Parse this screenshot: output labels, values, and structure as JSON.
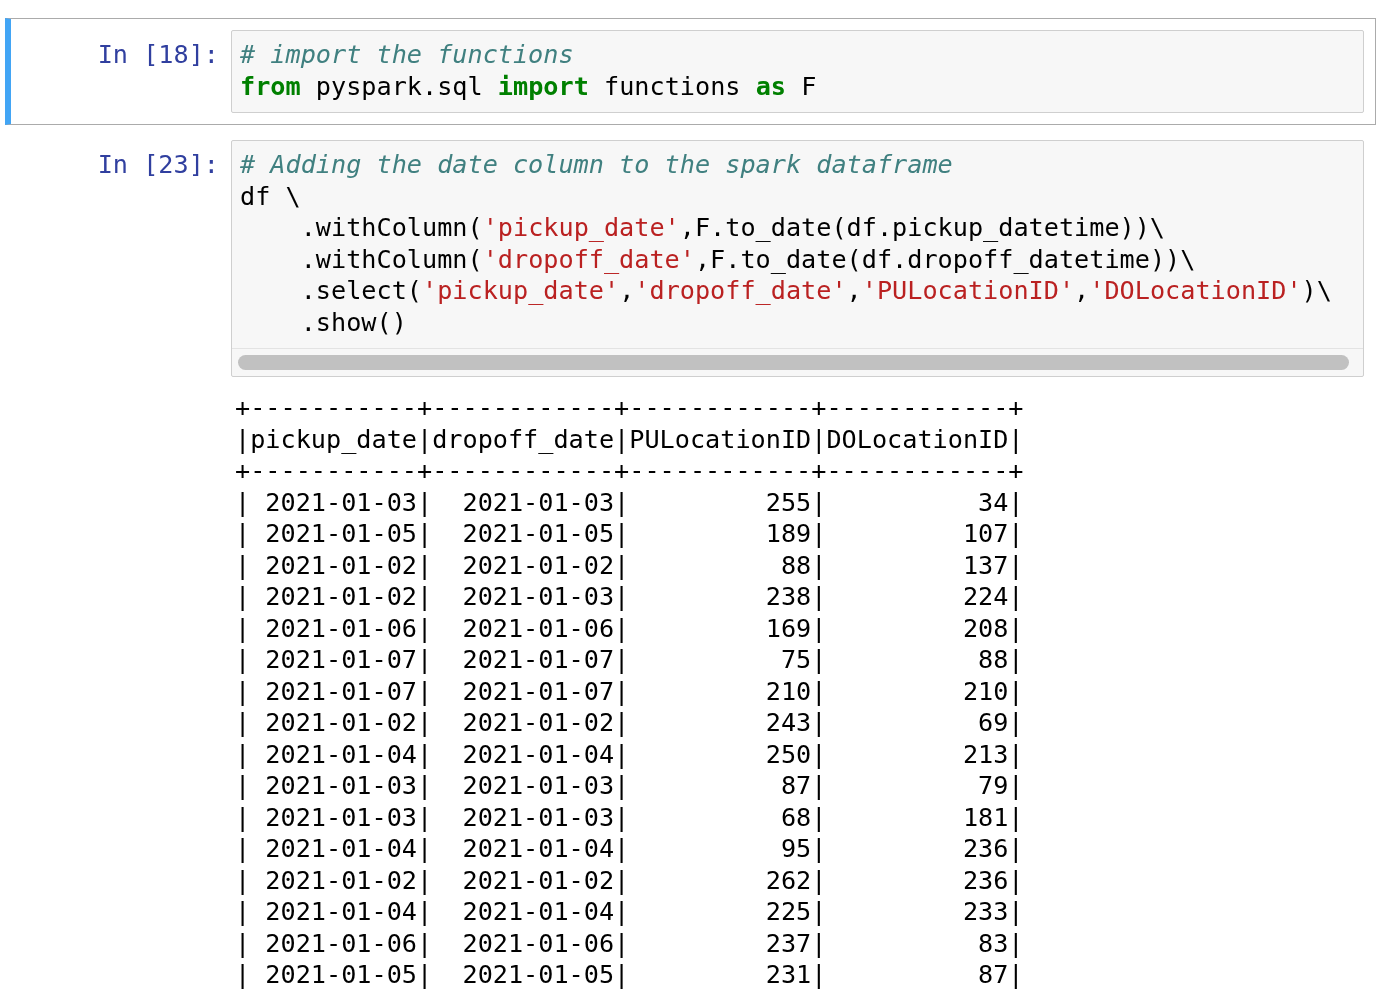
{
  "cells": [
    {
      "prompt": "In [18]:",
      "selected": true,
      "code_lines": [
        [
          {
            "kind": "comment",
            "text": "# import the functions"
          }
        ],
        [
          {
            "kind": "keyword",
            "text": "from"
          },
          {
            "kind": "plain",
            "text": " pyspark.sql "
          },
          {
            "kind": "keyword",
            "text": "import"
          },
          {
            "kind": "plain",
            "text": " functions "
          },
          {
            "kind": "keyword",
            "text": "as"
          },
          {
            "kind": "plain",
            "text": " F"
          }
        ]
      ],
      "scrollbar": false
    },
    {
      "prompt": "In [23]:",
      "selected": false,
      "code_lines": [
        [
          {
            "kind": "comment",
            "text": "# Adding the date column to the spark dataframe"
          }
        ],
        [
          {
            "kind": "plain",
            "text": "df \\"
          }
        ],
        [
          {
            "kind": "plain",
            "text": "    .withColumn("
          },
          {
            "kind": "string",
            "text": "'pickup_date'"
          },
          {
            "kind": "plain",
            "text": ",F.to_date(df.pickup_datetime))\\"
          }
        ],
        [
          {
            "kind": "plain",
            "text": "    .withColumn("
          },
          {
            "kind": "string",
            "text": "'dropoff_date'"
          },
          {
            "kind": "plain",
            "text": ",F.to_date(df.dropoff_datetime))\\"
          }
        ],
        [
          {
            "kind": "plain",
            "text": "    .select("
          },
          {
            "kind": "string",
            "text": "'pickup_date'"
          },
          {
            "kind": "plain",
            "text": ","
          },
          {
            "kind": "string",
            "text": "'dropoff_date'"
          },
          {
            "kind": "plain",
            "text": ","
          },
          {
            "kind": "string",
            "text": "'PULocationID'"
          },
          {
            "kind": "plain",
            "text": ","
          },
          {
            "kind": "string",
            "text": "'DOLocationID'"
          },
          {
            "kind": "plain",
            "text": ")\\"
          }
        ],
        [
          {
            "kind": "plain",
            "text": "    .show()"
          }
        ]
      ],
      "scrollbar": true,
      "output_lines": [
        "+-----------+------------+------------+------------+",
        "|pickup_date|dropoff_date|PULocationID|DOLocationID|",
        "+-----------+------------+------------+------------+",
        "| 2021-01-03|  2021-01-03|         255|          34|",
        "| 2021-01-05|  2021-01-05|         189|         107|",
        "| 2021-01-02|  2021-01-02|          88|         137|",
        "| 2021-01-02|  2021-01-03|         238|         224|",
        "| 2021-01-06|  2021-01-06|         169|         208|",
        "| 2021-01-07|  2021-01-07|          75|          88|",
        "| 2021-01-07|  2021-01-07|         210|         210|",
        "| 2021-01-02|  2021-01-02|         243|          69|",
        "| 2021-01-04|  2021-01-04|         250|         213|",
        "| 2021-01-03|  2021-01-03|          87|          79|",
        "| 2021-01-03|  2021-01-03|          68|         181|",
        "| 2021-01-04|  2021-01-04|          95|         236|",
        "| 2021-01-02|  2021-01-02|         262|         236|",
        "| 2021-01-04|  2021-01-04|         225|         233|",
        "| 2021-01-06|  2021-01-06|         237|          83|",
        "| 2021-01-05|  2021-01-05|         231|          87|"
      ]
    }
  ]
}
